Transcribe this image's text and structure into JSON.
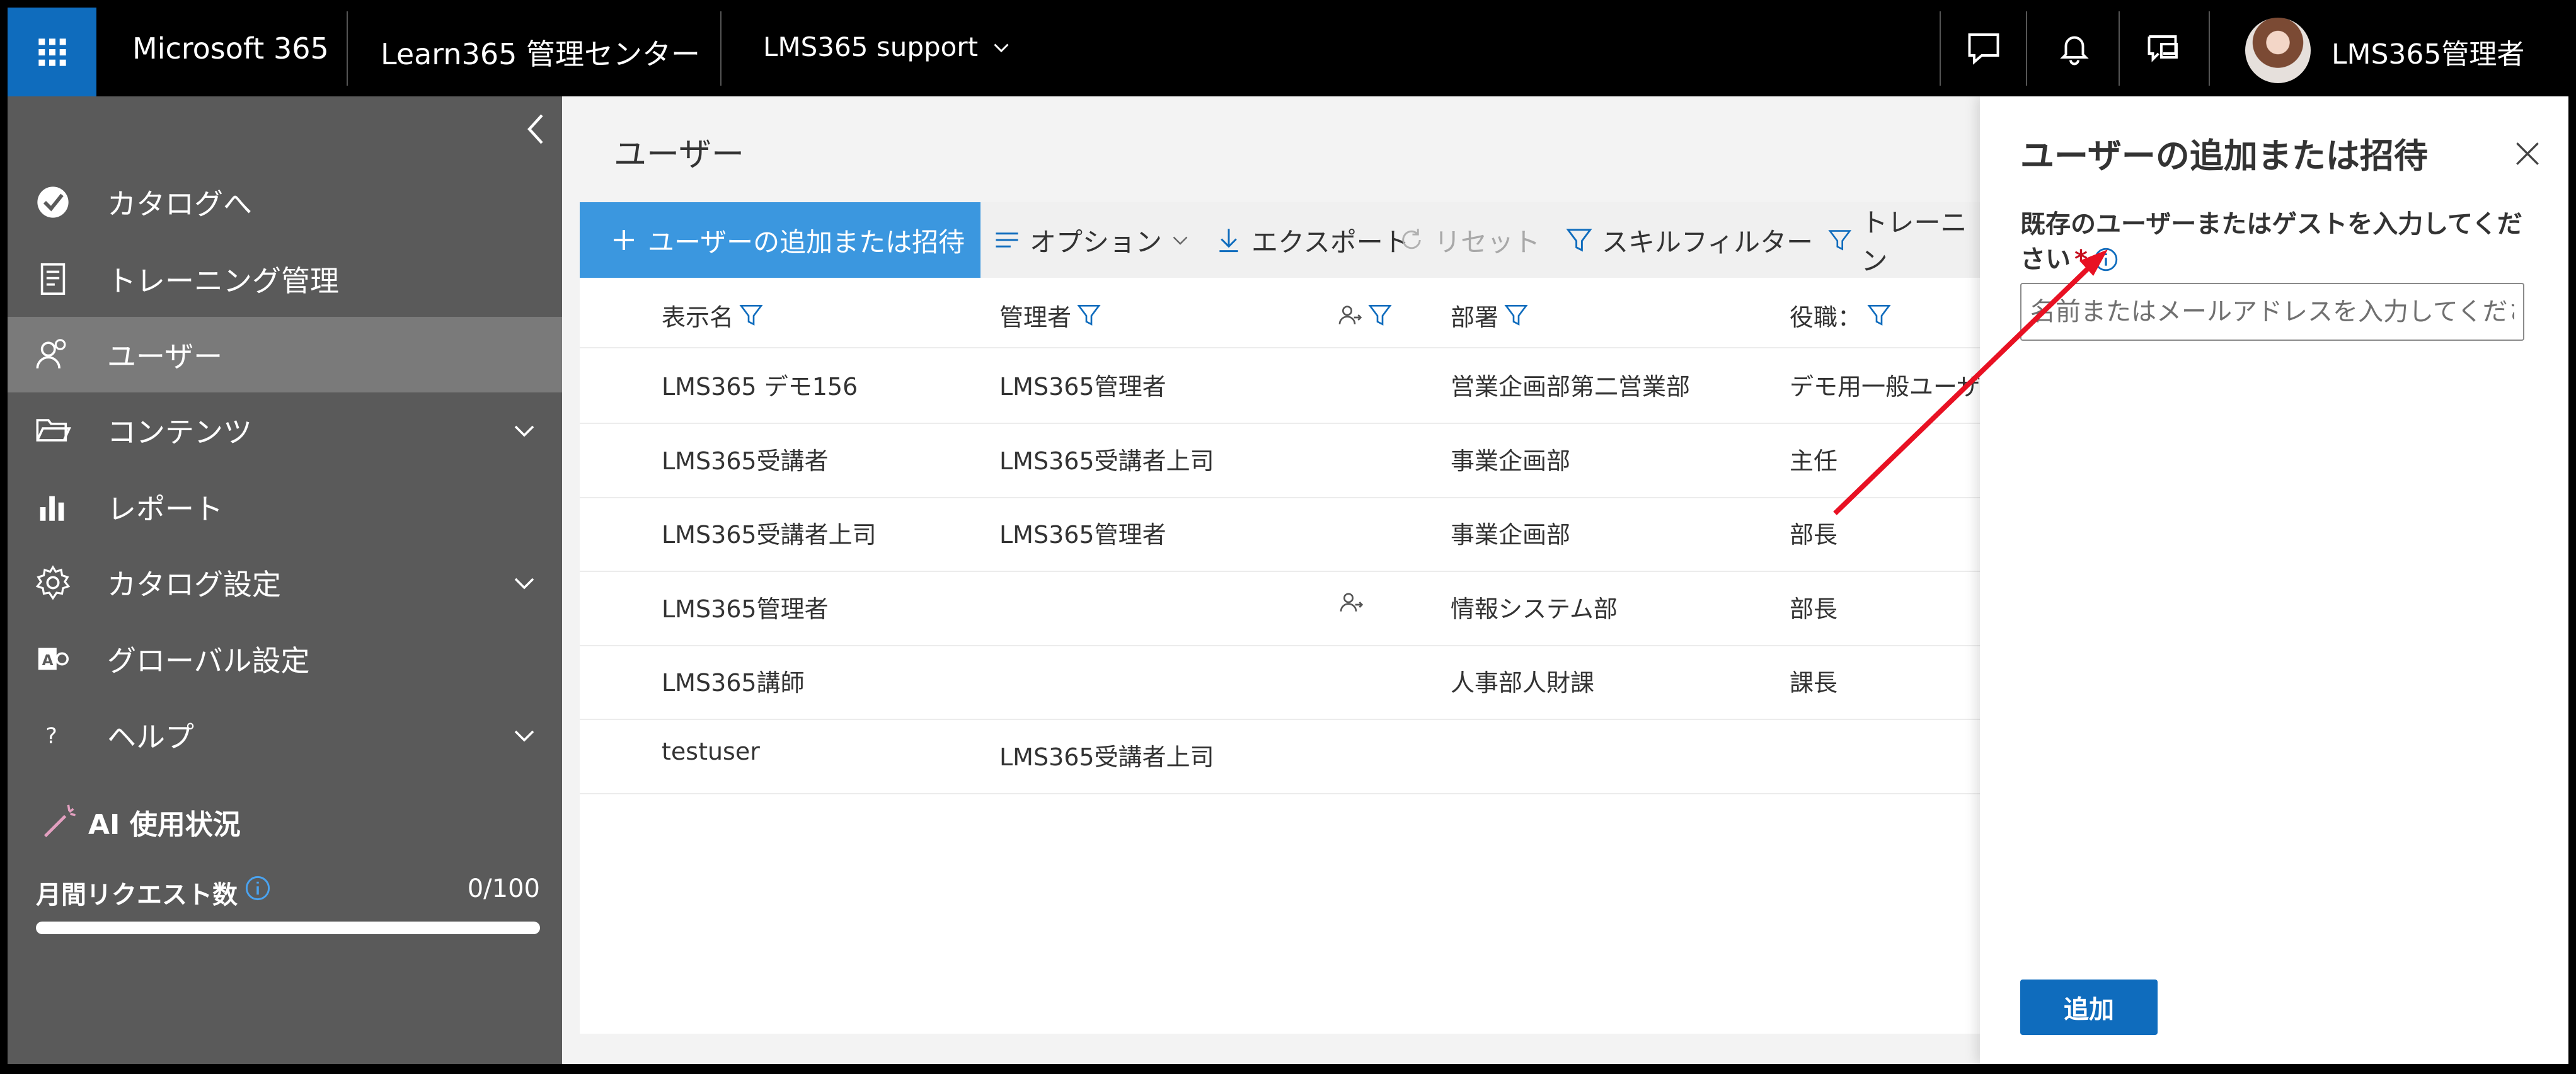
{
  "topbar": {
    "brand": "Microsoft 365",
    "center_title": "Learn365 管理センター",
    "tenant": "LMS365 support",
    "user_name": "LMS365管理者"
  },
  "sidebar": {
    "items": [
      {
        "label": "カタログへ",
        "icon": "catalog-check-icon"
      },
      {
        "label": "トレーニング管理",
        "icon": "training-icon"
      },
      {
        "label": "ユーザー",
        "icon": "users-icon",
        "active": true
      },
      {
        "label": "コンテンツ",
        "icon": "folder-icon",
        "expandable": true
      },
      {
        "label": "レポート",
        "icon": "chart-icon"
      },
      {
        "label": "カタログ設定",
        "icon": "gear-icon",
        "expandable": true
      },
      {
        "label": "グローバル設定",
        "icon": "global-settings-icon"
      },
      {
        "label": "ヘルプ",
        "icon": "help-icon",
        "expandable": true
      }
    ],
    "ai_title": "AI 使用状況",
    "request_label": "月間リクエスト数",
    "request_count": "0/100",
    "request_fraction": 0.0
  },
  "main": {
    "page_title": "ユーザー",
    "commands": {
      "add_invite": "ユーザーの追加または招待",
      "options": "オプション",
      "export": "エクスポート",
      "reset": "リセット",
      "skill_filter": "スキルフィルター",
      "training_filter": "トレーニン"
    },
    "columns": {
      "display_name": "表示名",
      "manager": "管理者",
      "department": "部署",
      "title": "役職："
    },
    "rows": [
      {
        "name": "LMS365 デモ156",
        "manager": "LMS365管理者",
        "dept": "営業企画部第二営業部",
        "title": "デモ用一般ユーザー",
        "delegate": false
      },
      {
        "name": "LMS365受講者",
        "manager": "LMS365受講者上司",
        "dept": "事業企画部",
        "title": "主任",
        "delegate": false
      },
      {
        "name": "LMS365受講者上司",
        "manager": "LMS365管理者",
        "dept": "事業企画部",
        "title": "部長",
        "delegate": false
      },
      {
        "name": "LMS365管理者",
        "manager": "",
        "dept": "情報システム部",
        "title": "部長",
        "delegate": true
      },
      {
        "name": "LMS365講師",
        "manager": "",
        "dept": "人事部人財課",
        "title": "課長",
        "delegate": false
      },
      {
        "name": "testuser",
        "manager": "LMS365受講者上司",
        "dept": "",
        "title": "",
        "delegate": false
      }
    ]
  },
  "panel": {
    "title": "ユーザーの追加または招待",
    "field_label": "既存のユーザーまたはゲストを入力してください",
    "required_mark": "*",
    "input_placeholder": "名前またはメールアドレスを入力してください",
    "input_value": "",
    "add_button": "追加"
  },
  "colors": {
    "accent": "#0f6cbd",
    "primary_button": "#3b97df",
    "sidebar_bg": "#5a5a5a",
    "sidebar_active": "#7a7a7a",
    "annotation_arrow": "#e81123"
  }
}
